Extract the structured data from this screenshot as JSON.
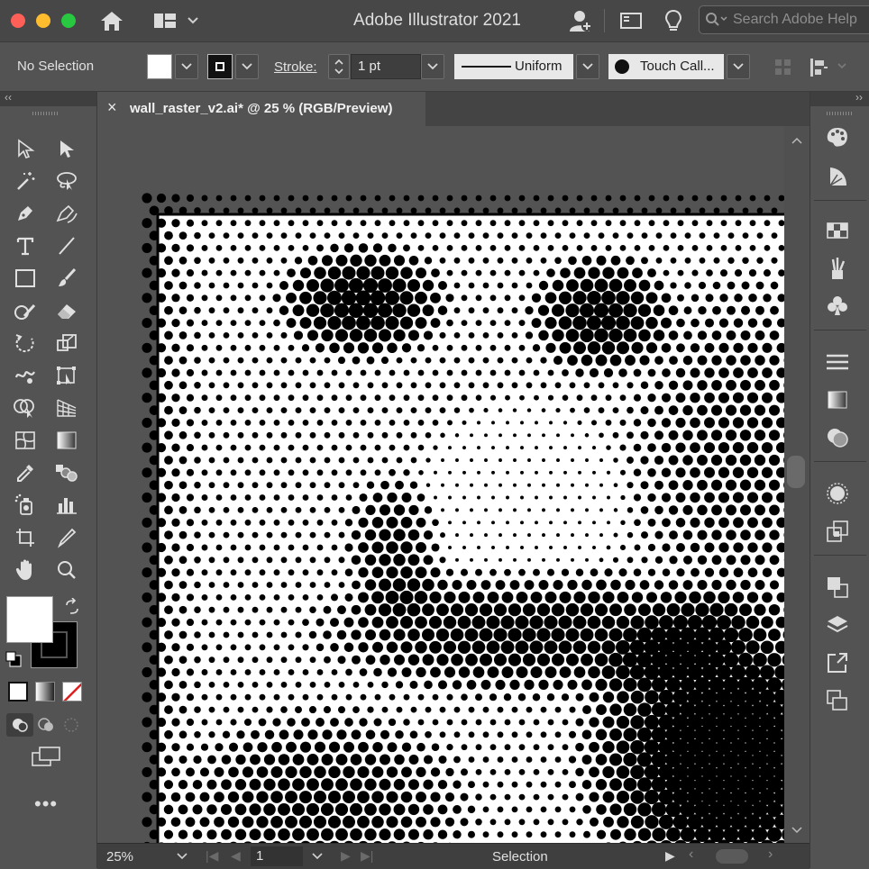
{
  "app": {
    "title": "Adobe Illustrator 2021"
  },
  "search": {
    "placeholder": "Search Adobe Help"
  },
  "control_bar": {
    "selection_status": "No Selection",
    "stroke_label": "Stroke:",
    "stroke_weight": "1 pt",
    "stroke_profile": "Uniform",
    "brush_name": "Touch Call..."
  },
  "document": {
    "tab_title": "wall_raster_v2.ai* @ 25 % (RGB/Preview)"
  },
  "status_bar": {
    "zoom": "25%",
    "artboard": "1",
    "current_tool": "Selection"
  },
  "colors": {
    "ui_dark": "#535353",
    "canvas_white": "#ffffff",
    "halftone": "#000000"
  },
  "toolbar": {
    "tools": [
      "selection-tool-icon",
      "direct-selection-tool-icon",
      "magic-wand-tool-icon",
      "lasso-tool-icon",
      "pen-tool-icon",
      "curvature-tool-icon",
      "type-tool-icon",
      "line-segment-tool-icon",
      "rectangle-tool-icon",
      "paintbrush-tool-icon",
      "shaper-tool-icon",
      "eraser-tool-icon",
      "rotate-tool-icon",
      "scale-tool-icon",
      "warp-tool-icon",
      "free-transform-tool-icon",
      "shape-builder-tool-icon",
      "perspective-grid-tool-icon",
      "mesh-tool-icon",
      "gradient-tool-icon",
      "eyedropper-tool-icon",
      "blend-tool-icon",
      "symbol-sprayer-tool-icon",
      "column-graph-tool-icon",
      "artboard-tool-icon",
      "slice-tool-icon",
      "hand-tool-icon",
      "zoom-tool-icon"
    ]
  },
  "right_panels": [
    "color-panel-icon",
    "color-guide-panel-icon",
    "swatches-panel-icon",
    "brushes-panel-icon",
    "symbols-panel-icon",
    "stroke-panel-icon",
    "gradient-panel-icon",
    "transparency-panel-icon",
    "appearance-panel-icon",
    "graphic-styles-panel-icon",
    "pathfinder-panel-icon",
    "layers-panel-icon",
    "export-panel-icon",
    "artboards-panel-icon"
  ]
}
